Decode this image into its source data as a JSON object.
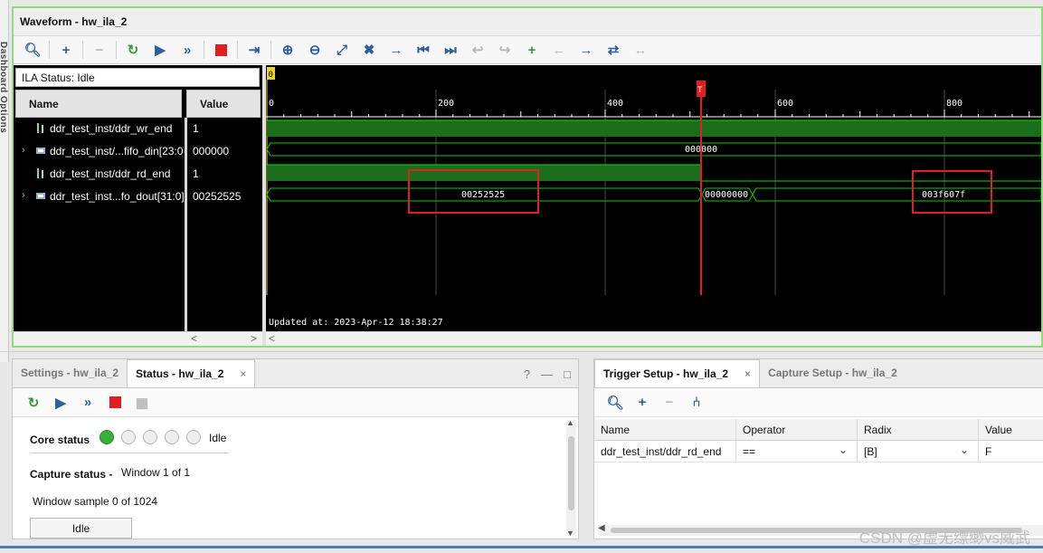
{
  "left_strip": {
    "text": "Dashboard Options"
  },
  "waveform": {
    "title": "Waveform - hw_ila_2",
    "ila_status": "ILA Status: Idle",
    "col_name": "Name",
    "col_value": "Value",
    "signals": [
      {
        "name": "ddr_test_inst/ddr_wr_end",
        "value": "1",
        "type": "bit",
        "expandable": false
      },
      {
        "name": "ddr_test_inst/...fifo_din[23:0]",
        "value": "000000",
        "type": "bus",
        "expandable": true
      },
      {
        "name": "ddr_test_inst/ddr_rd_end",
        "value": "1",
        "type": "bit",
        "expandable": false
      },
      {
        "name": "ddr_test_inst...fo_dout[31:0]",
        "value": "00252525",
        "type": "bus",
        "expandable": true
      }
    ],
    "marker_zero": "0",
    "trigger_marker": "T",
    "ruler_labels": [
      "0",
      "200",
      "400",
      "600",
      "800"
    ],
    "bus_values": {
      "fifo_din": "000000",
      "fo_dout_a": "00252525",
      "fo_dout_b": "00000000",
      "fo_dout_c": "003f607f"
    },
    "updated_at": "Updated at: 2023-Apr-12 18:38:27",
    "arrow_left": "<",
    "arrow_right": ">"
  },
  "status_panel": {
    "tabs": [
      {
        "label": "Settings - hw_ila_2",
        "active": false
      },
      {
        "label": "Status - hw_ila_2",
        "active": true
      }
    ],
    "close": "×",
    "help": "?",
    "core_status_label": "Core status",
    "core_status_value": "Idle",
    "capture_status_label": "Capture status -",
    "capture_status_value": "Window 1 of 1",
    "window_sample": "Window sample 0 of 1024",
    "idle_button": "Idle"
  },
  "trigger_panel": {
    "tabs": [
      {
        "label": "Trigger Setup - hw_ila_2",
        "active": true
      },
      {
        "label": "Capture Setup - hw_ila_2",
        "active": false
      }
    ],
    "close": "×",
    "columns": [
      "Name",
      "Operator",
      "Radix",
      "Value"
    ],
    "rows": [
      {
        "name": "ddr_test_inst/ddr_rd_end",
        "operator": "==",
        "radix": "[B]",
        "value": "F"
      }
    ]
  },
  "watermark": "CSDN @虚无缥缈vs威武",
  "colors": {
    "window_border": "#8fdc7a",
    "wave_green": "#1f7a1f",
    "wave_line": "#00ff00",
    "trigger_red": "#e02020",
    "highlight_box": "#e02020"
  }
}
